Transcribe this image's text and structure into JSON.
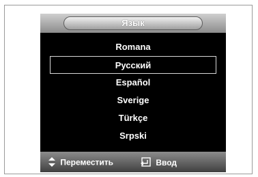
{
  "menu": {
    "title": "Язык",
    "items": [
      {
        "label": "Romana",
        "selected": false
      },
      {
        "label": "Русский",
        "selected": true
      },
      {
        "label": "Español",
        "selected": false
      },
      {
        "label": "Sverige",
        "selected": false
      },
      {
        "label": "Türkçe",
        "selected": false
      },
      {
        "label": "Srpski",
        "selected": false
      }
    ]
  },
  "footer": {
    "move_icon": "up-down-arrows-icon",
    "move_label": "Переместить",
    "enter_icon": "enter-icon",
    "enter_label": "Ввод"
  }
}
